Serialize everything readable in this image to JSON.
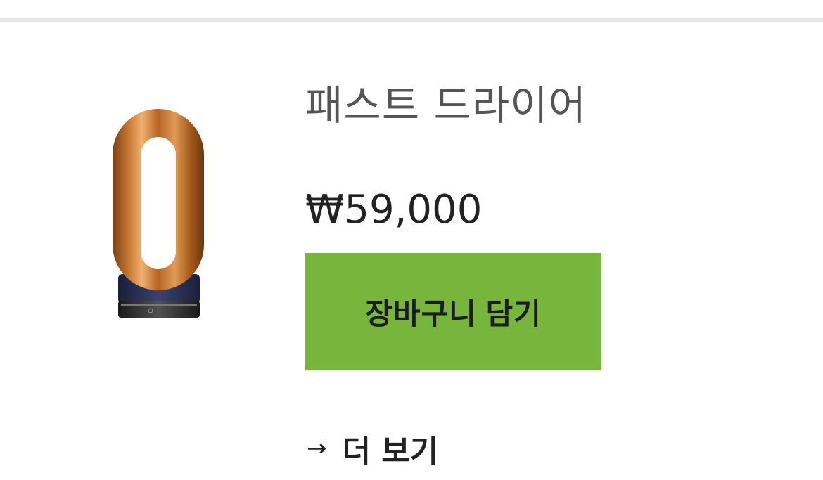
{
  "product": {
    "image_icon": "hair-dryer-attachment-icon",
    "title": "패스트 드라이어",
    "price": "₩59,000"
  },
  "cart_button": {
    "label": "장바구니 담기",
    "background_color": "#77b53c"
  },
  "more_link": {
    "icon": "arrow-right-icon",
    "arrow": "→",
    "label": "더 보기"
  }
}
